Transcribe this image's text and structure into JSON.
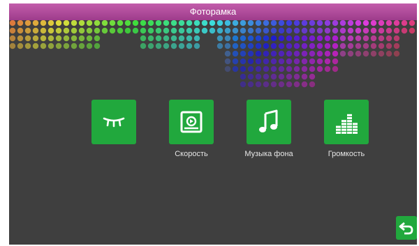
{
  "window": {
    "title": "Фоторамка"
  },
  "menu": {
    "items": [
      {
        "id": "screensaver",
        "icon": "closed-eye-icon",
        "label": "",
        "active": true
      },
      {
        "id": "speed",
        "icon": "photo-slideshow-icon",
        "label": "Скорость",
        "active": false
      },
      {
        "id": "music",
        "icon": "music-note-icon",
        "label": "Музыка фона",
        "active": false
      },
      {
        "id": "volume",
        "icon": "equalizer-icon",
        "label": "Громкость",
        "active": false
      }
    ]
  },
  "colors": {
    "title_bar": "#b04d9c",
    "tile": "#21a83d",
    "background": "#3f3f3f",
    "active_label": "#e3231f",
    "label": "#e6e6e6"
  },
  "back_button": {
    "icon": "back-arrow-icon"
  }
}
